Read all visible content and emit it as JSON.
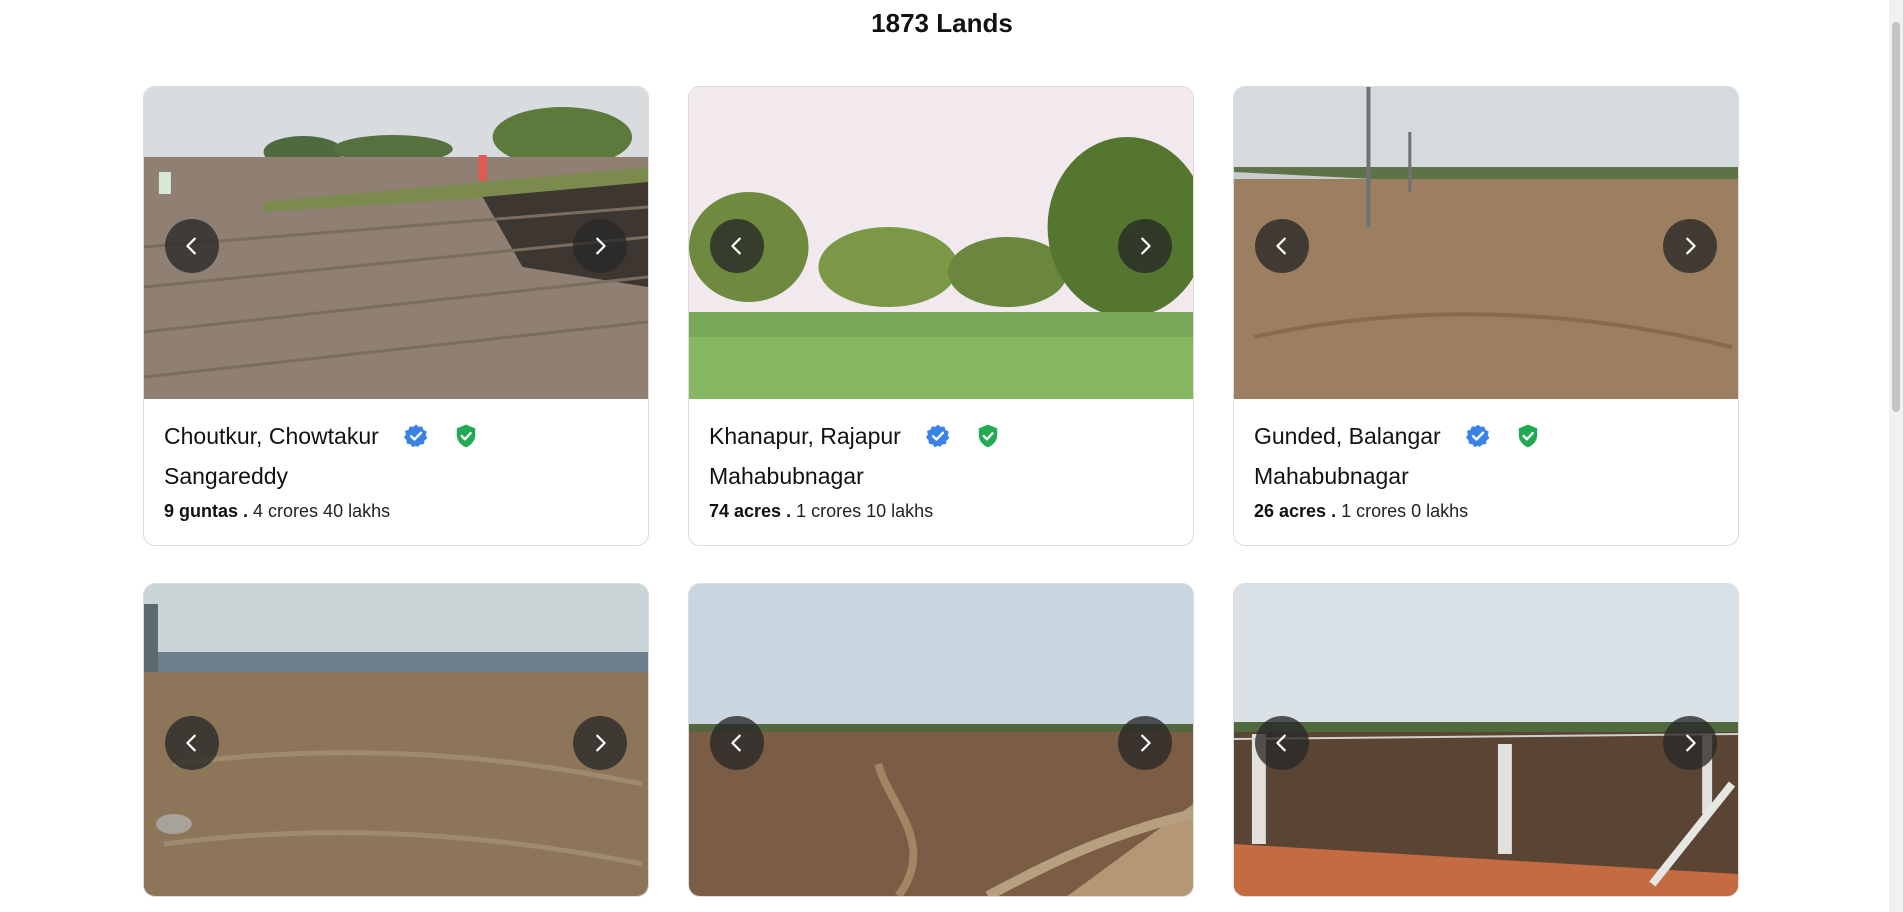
{
  "header": {
    "title": "1873 Lands"
  },
  "listings": [
    {
      "location": "Choutkur, Chowtakur",
      "district": "Sangareddy",
      "area": "9 guntas .",
      "price": "4 crores 40 lakhs",
      "scene": "plowed"
    },
    {
      "location": "Khanapur, Rajapur",
      "district": "Mahabubnagar",
      "area": "74 acres .",
      "price": "1 crores 10 lakhs",
      "scene": "green"
    },
    {
      "location": "Gunded, Balangar",
      "district": "Mahabubnagar",
      "area": "26 acres .",
      "price": "1 crores 0 lakhs",
      "scene": "fenced"
    },
    {
      "location": "",
      "district": "",
      "area": "",
      "price": "",
      "scene": "dry-wall"
    },
    {
      "location": "",
      "district": "",
      "area": "",
      "price": "",
      "scene": "brown-field"
    },
    {
      "location": "",
      "district": "",
      "area": "",
      "price": "",
      "scene": "poles"
    }
  ],
  "icons": {
    "verified": "verified-badge-icon",
    "approved": "shield-check-icon",
    "prev": "chevron-left-icon",
    "next": "chevron-right-icon"
  },
  "colors": {
    "verified": "#3b82e6",
    "approved": "#22a954",
    "nav_button": "#282828"
  }
}
